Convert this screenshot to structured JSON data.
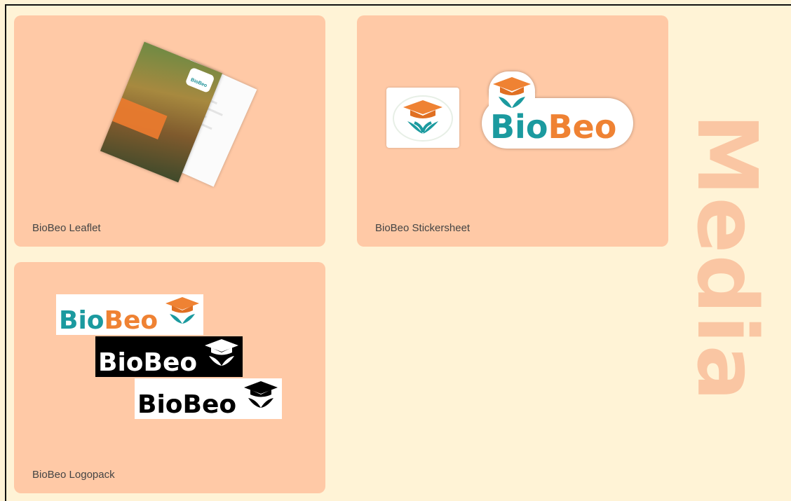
{
  "section": {
    "title": "Media"
  },
  "cards": {
    "leaflet": {
      "label": "BioBeo Leaflet"
    },
    "stickersheet": {
      "label": "BioBeo Stickersheet"
    },
    "logopack": {
      "label": "BioBeo Logopack"
    }
  },
  "brand": {
    "name_part1": "Bio",
    "name_part2": "Beo",
    "leaflet_tag": "BioBeo",
    "colors": {
      "teal": "#1b9a9f",
      "orange": "#ef8233",
      "card": "#ffc9a6",
      "page": "#fff3d6"
    }
  }
}
